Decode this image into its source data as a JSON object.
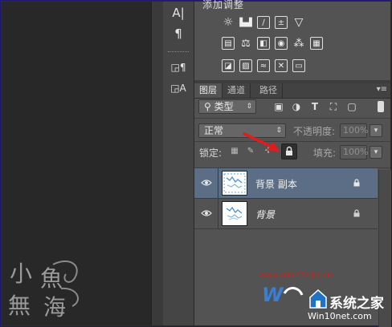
{
  "adjustments": {
    "title": "添加调整"
  },
  "tabs": [
    "图层",
    "通道",
    "路径"
  ],
  "filter": {
    "kind_label": "类型"
  },
  "blend": {
    "mode": "正常",
    "opacity_label": "不透明度:",
    "opacity_value": "100%"
  },
  "lock": {
    "label": "锁定:",
    "fill_label": "填充:",
    "fill_value": "100%"
  },
  "layers": [
    {
      "name": "背景 副本",
      "selected": true
    },
    {
      "name": "背景",
      "selected": false
    }
  ],
  "watermark": {
    "url": "www.win7zhijia.cn",
    "win_url": "Win10net.com",
    "brand": "系统之家",
    "corner_chars": [
      "小",
      "魚",
      "無",
      "海"
    ]
  },
  "colors": {
    "arrow": "#e01c1c",
    "selected_row": "#5b6e85",
    "panel": "#535353"
  }
}
